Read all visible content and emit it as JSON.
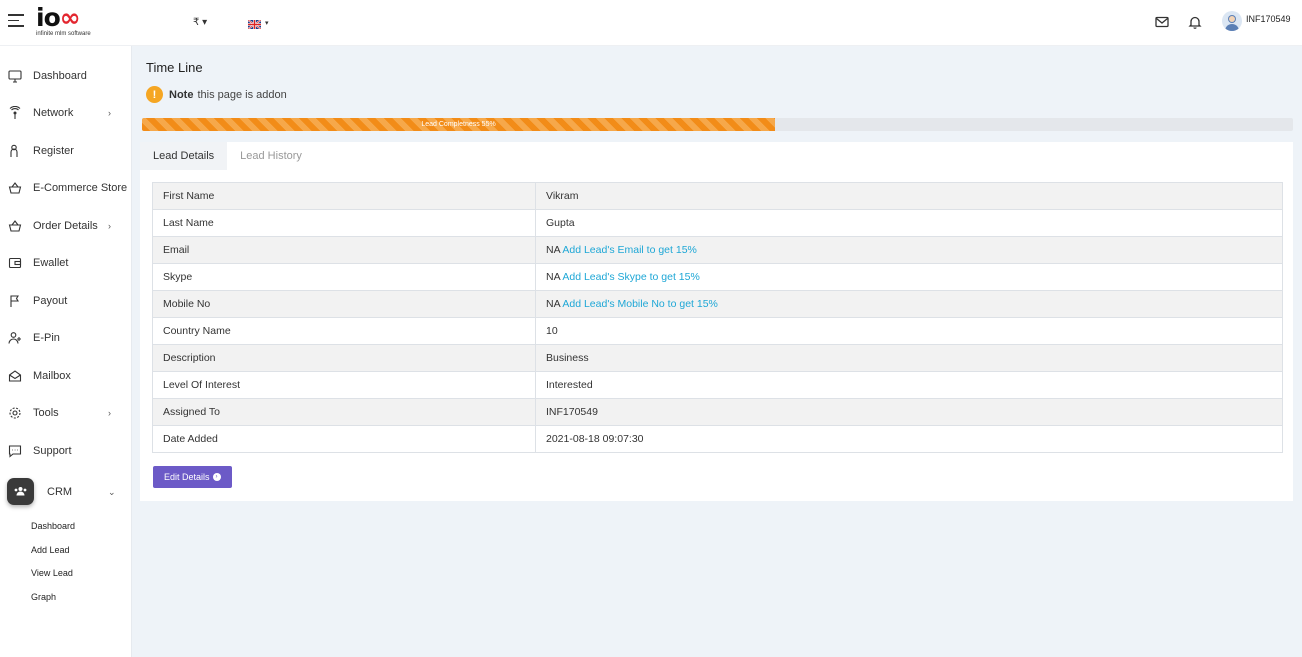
{
  "header": {
    "logo_text": "io",
    "logo_infinity": "∞",
    "logo_sub": "infinite mlm software",
    "currency": "₹ ▾",
    "username": "INF170549"
  },
  "sidebar": {
    "items": [
      {
        "label": "Dashboard",
        "icon": "monitor-icon",
        "chevron": ""
      },
      {
        "label": "Network",
        "icon": "network-icon",
        "chevron": "›"
      },
      {
        "label": "Register",
        "icon": "register-icon",
        "chevron": ""
      },
      {
        "label": "E-Commerce Store",
        "icon": "basket-icon",
        "chevron": ""
      },
      {
        "label": "Order Details",
        "icon": "basket-icon",
        "chevron": "›"
      },
      {
        "label": "Ewallet",
        "icon": "wallet-icon",
        "chevron": ""
      },
      {
        "label": "Payout",
        "icon": "flag-icon",
        "chevron": ""
      },
      {
        "label": "E-Pin",
        "icon": "user-plus-icon",
        "chevron": ""
      },
      {
        "label": "Mailbox",
        "icon": "mailbox-icon",
        "chevron": ""
      },
      {
        "label": "Tools",
        "icon": "gear-icon",
        "chevron": "›"
      },
      {
        "label": "Support",
        "icon": "chat-icon",
        "chevron": ""
      }
    ],
    "crm": {
      "label": "CRM",
      "chevron": "⌄"
    },
    "crm_subitems": [
      "Dashboard",
      "Add Lead",
      "View Lead",
      "Graph"
    ]
  },
  "main": {
    "title": "Time Line",
    "note_bold": "Note",
    "note_text": "this page is addon",
    "note_icon": "!",
    "progress": {
      "label": "Lead Completness 55%",
      "percent": 55
    },
    "tabs": [
      {
        "label": "Lead Details",
        "active": true
      },
      {
        "label": "Lead History",
        "active": false
      }
    ],
    "rows": [
      {
        "key": "First Name",
        "value": "Vikram",
        "link": ""
      },
      {
        "key": "Last Name",
        "value": "Gupta",
        "link": ""
      },
      {
        "key": "Email",
        "value": "NA",
        "link": "Add Lead's Email to get 15%"
      },
      {
        "key": "Skype",
        "value": "NA",
        "link": "Add Lead's Skype to get 15%"
      },
      {
        "key": "Mobile No",
        "value": "NA",
        "link": "Add Lead's Mobile No to get 15%"
      },
      {
        "key": "Country Name",
        "value": "10",
        "link": ""
      },
      {
        "key": "Description",
        "value": "Business",
        "link": ""
      },
      {
        "key": "Level Of Interest",
        "value": "Interested",
        "link": ""
      },
      {
        "key": "Assigned To",
        "value": "INF170549",
        "link": ""
      },
      {
        "key": "Date Added",
        "value": "2021-08-18 09:07:30",
        "link": ""
      }
    ],
    "edit_button": "Edit Details",
    "edit_arrow": "›"
  },
  "colors": {
    "accent": "#6c5ac7",
    "progress": "#f28c18",
    "link": "#1ea7d6",
    "warn": "#f5a623"
  }
}
